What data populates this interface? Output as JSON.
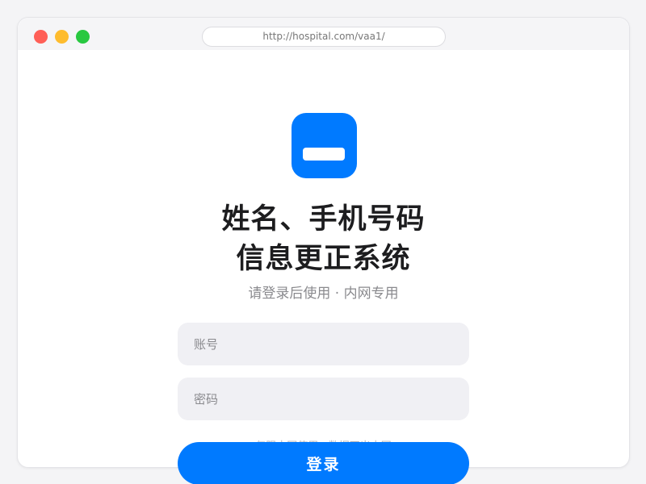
{
  "colors": {
    "accent": "#007aff",
    "close": "#ff5f57",
    "minimize": "#febc2e",
    "zoom": "#28c840"
  },
  "browser": {
    "url": "http://hospital.com/vaa1/"
  },
  "app": {
    "logo_icon": "id-card-icon",
    "title_line1": "姓名、手机号码",
    "title_line2": "信息更正系统",
    "subtitle": "请登录后使用 · 内网专用"
  },
  "form": {
    "account_placeholder": "账号",
    "password_placeholder": "密码",
    "notice": "仅限内网使用 · 数据不出内网",
    "login_label": "登录"
  }
}
